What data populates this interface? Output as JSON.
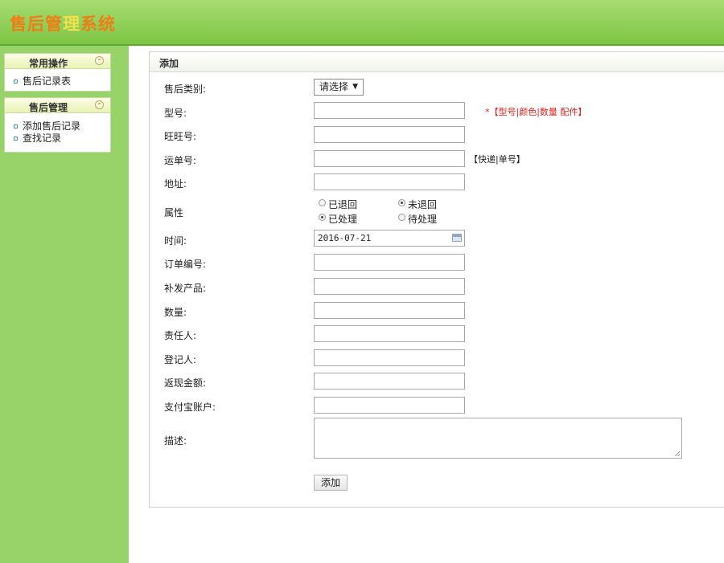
{
  "header": {
    "title_part1": "售后管",
    "title_part2": "理",
    "title_part3": "系统"
  },
  "sidebar": {
    "groups": [
      {
        "title": "常用操作",
        "items": [
          {
            "label": "售后记录表"
          }
        ]
      },
      {
        "title": "售后管理",
        "items": [
          {
            "label": "添加售后记录"
          },
          {
            "label": "查找记录"
          }
        ]
      }
    ]
  },
  "panel": {
    "title": "添加"
  },
  "form": {
    "category_label": "售后类别:",
    "category_value": "请选择",
    "model_label": "型号:",
    "model_hint": "*【型号|颜色|数量 配件】",
    "wangwang_label": "旺旺号:",
    "waybill_label": "运单号:",
    "waybill_hint": "【快递|单号】",
    "address_label": "地址:",
    "attr_label": "属性",
    "radio_returned": "已退回",
    "radio_not_returned": "未退回",
    "radio_processed": "已处理",
    "radio_pending": "待处理",
    "time_label": "时间:",
    "time_value": "2016-07-21",
    "order_label": "订单编号:",
    "reissue_label": "补发产品:",
    "qty_label": "数量:",
    "owner_label": "责任人:",
    "registrar_label": "登记人:",
    "refund_label": "返现金额:",
    "alipay_label": "支付宝账户:",
    "desc_label": "描述:",
    "submit_label": "添加"
  },
  "colors": {
    "header_green": "#7ec544",
    "sidebar_green": "#98d36a",
    "title_orange": "#f07d14",
    "hint_red": "#e0201a"
  }
}
